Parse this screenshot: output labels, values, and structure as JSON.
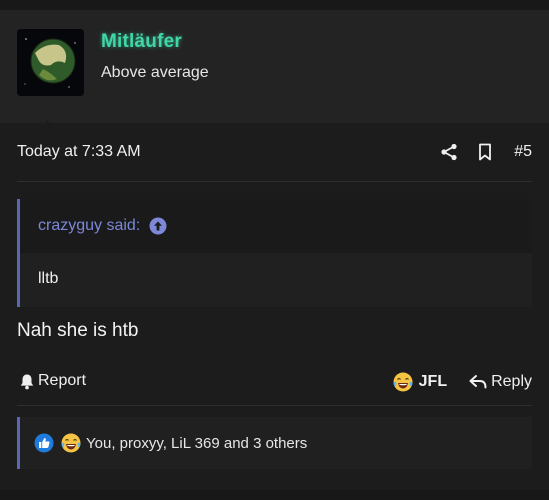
{
  "user": {
    "name": "Mitläufer",
    "title": "Above average"
  },
  "post": {
    "timestamp": "Today at 7:33 AM",
    "number": "#5",
    "message": "Nah she is htb"
  },
  "quote": {
    "attribution": "crazyguy said:",
    "text": "lltb"
  },
  "actions": {
    "report_label": "Report",
    "reaction_label": "JFL",
    "reply_label": "Reply"
  },
  "reactions": {
    "summary": "You, proxyy, LiL 369 and 3 others"
  },
  "icons": [
    "share-icon",
    "bookmark-icon",
    "arrow-up-circle-icon",
    "bell-icon",
    "laughing-crying-emoji-icon",
    "reply-arrow-icon",
    "like-icon"
  ],
  "colors": {
    "background": "#1c1c1c",
    "username": "#3fd6a8",
    "quote_accent": "#5b66b8",
    "quote_author": "#7d88d8",
    "like_blue": "#1f7bdc"
  }
}
